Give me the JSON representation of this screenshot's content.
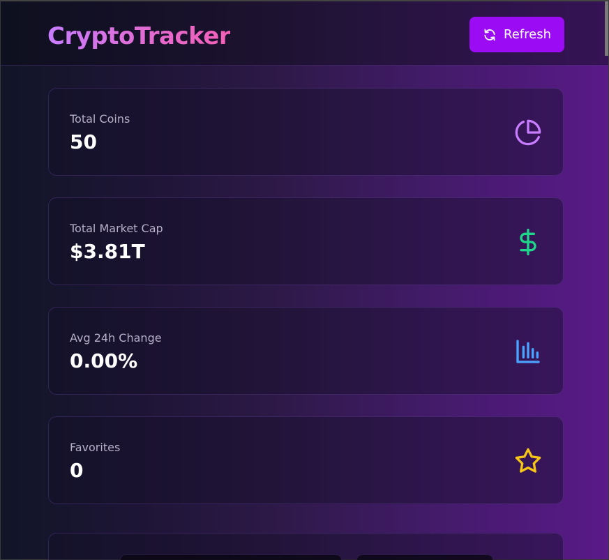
{
  "header": {
    "title": "CryptoTracker",
    "refresh_label": "Refresh"
  },
  "stats": [
    {
      "label": "Total Coins",
      "value": "50",
      "icon": "pie-chart-icon",
      "color": "#c77dff"
    },
    {
      "label": "Total Market Cap",
      "value": "$3.81T",
      "icon": "dollar-icon",
      "color": "#1fd68a"
    },
    {
      "label": "Avg 24h Change",
      "value": "0.00%",
      "icon": "bar-chart-icon",
      "color": "#4aa3ff"
    },
    {
      "label": "Favorites",
      "value": "0",
      "icon": "star-icon",
      "color": "#f5c518"
    }
  ],
  "colors": {
    "accent": "#9b0cf5"
  }
}
